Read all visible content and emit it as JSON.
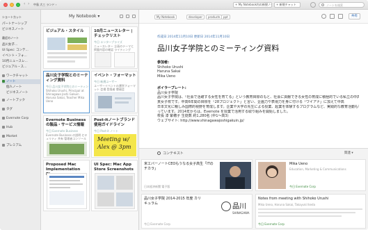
{
  "toolbar": {
    "nav_text": "中島 大三 ランド ›",
    "add_account": "+ My Notebook内の新規ノート",
    "new_chat": "+ 新規チャット",
    "search_placeholder": "ノートを検索"
  },
  "sidebar": {
    "shortcuts_header": "ショートカット",
    "shortcuts": [
      "パートナーシップ",
      "ビジネスノート"
    ],
    "recent_header": "最近のノート",
    "recent": [
      "品川女子...",
      "UI Spec: コンテ...",
      "イベント・フォ...",
      "10月ニュースレ...",
      "ビジュアル・ス..."
    ],
    "main": [
      "ワークチャット",
      "ノート",
      "個人ノート",
      "ビジネスノート",
      "ノートブック",
      "タグ",
      "Evernote Corp",
      "Hub",
      "Market",
      "プレミアム"
    ],
    "active_index": 1
  },
  "notelist": {
    "title": "My Notebook ▾",
    "cards": [
      {
        "title": "ビジュアル・スタイル",
        "date": "",
        "snippet": ""
      },
      {
        "title": "10月ニュースレター | チェックリスト",
        "date": "今日 エンタープライズ",
        "snippet": "ニュースレター 企画のテーマと掲載内容の確認 ライティング"
      },
      {
        "title": "品川女子学院とのミーティング資料",
        "date": "今日 品川女子学院とのミーティング資料",
        "snippet": "Shihoko Urushi, Principal at Shinagawa Joshi Gakuin Haruna Sakai, Teacher Mika Ueno"
      },
      {
        "title": "イベント・フォーマット",
        "date": "今日 新規ユーザー",
        "snippet": "ユーザーイベントの運営フォーマット 会場 登壇者 懇親会"
      },
      {
        "title": "Evernote Businessの製品・サービス情報",
        "date": "今日 Evernote Business",
        "snippet": "Evernote Business の説明 セキュリティ 共有 管理者コンソール"
      },
      {
        "title": "Post-itノートブランド使用ガイドライン",
        "date": "今日 Post-it ノート",
        "snippet": ""
      },
      {
        "title": "Proposed Mac Implementation Plan",
        "date": "",
        "snippet": ""
      },
      {
        "title": "UI Spec: Mac App Store Screenshots",
        "date": "",
        "snippet": ""
      }
    ],
    "handwriting": [
      "Meeting w/",
      "Alex @ 3pm"
    ]
  },
  "editor": {
    "tags": [
      "My Notebook",
      "developer",
      "products",
      "ppt"
    ],
    "share_label": "共有",
    "meta": "作成日 2014年11月10日   更新日 2014年11月10日",
    "title": "品川女子学院とのミーティング資料",
    "attendees_label": "参加者:",
    "attendees": [
      "Shihoko Urushi",
      "Haruna Sakai",
      "Mika Ueno"
    ],
    "profile_label": "ボイラープレート:",
    "profile_lines": [
      "品川女子学院",
      "品川女子学院は、「社会で活躍する女性を育てる」という教育目標のもと、社会に貢献できる女性の育成に積極的でいる私立の中高一",
      "貫女子校です。中高6年間の目標を「28プロジェクト」と言い、企画力や表現力を身に付ける「ワイアナ」に加えて中高",
      "日本文化に親しみ国際的視野を育成します。企業や大学の先生による授業、起業を体験するプログラムなど、実践的な教育活動も行",
      "っています。2014年からは、Evernote を授業で活用する取り組みを開始しました。",
      "校長  漆 紫穂子    生徒数 約1,280名 (中1〜高3)",
      "ウェブサイト: http://www.shinagawajoshigakuin.jp/"
    ]
  },
  "context": {
    "label": "コンテキスト",
    "sort_label": "関連 ▾",
    "cards": [
      {
        "title": "米エバーノートCEOもうなる女子高生「ITのチカラ」",
        "source": "日本経済新聞 電子版"
      },
      {
        "title": "Mika Ueno",
        "source": "Education, Marketing & Communications"
      },
      {
        "title": "品川女子学院 2014-2015 年度 カリキュラム",
        "source": "今日 Evernote Corp"
      },
      {
        "title": "Notes from meeting with Shihoko Urushi",
        "source": "Mika Ueno, Haruna Sakai, Takayuki Ikeda"
      },
      {
        "title": "品川",
        "source": "SHINAGAWA"
      }
    ],
    "linked_note_date": "今日 Evernote Corp"
  },
  "colors": {
    "accent": "#2a67b1",
    "green": "#3b8a3d",
    "selection": "#5b9ad6"
  }
}
